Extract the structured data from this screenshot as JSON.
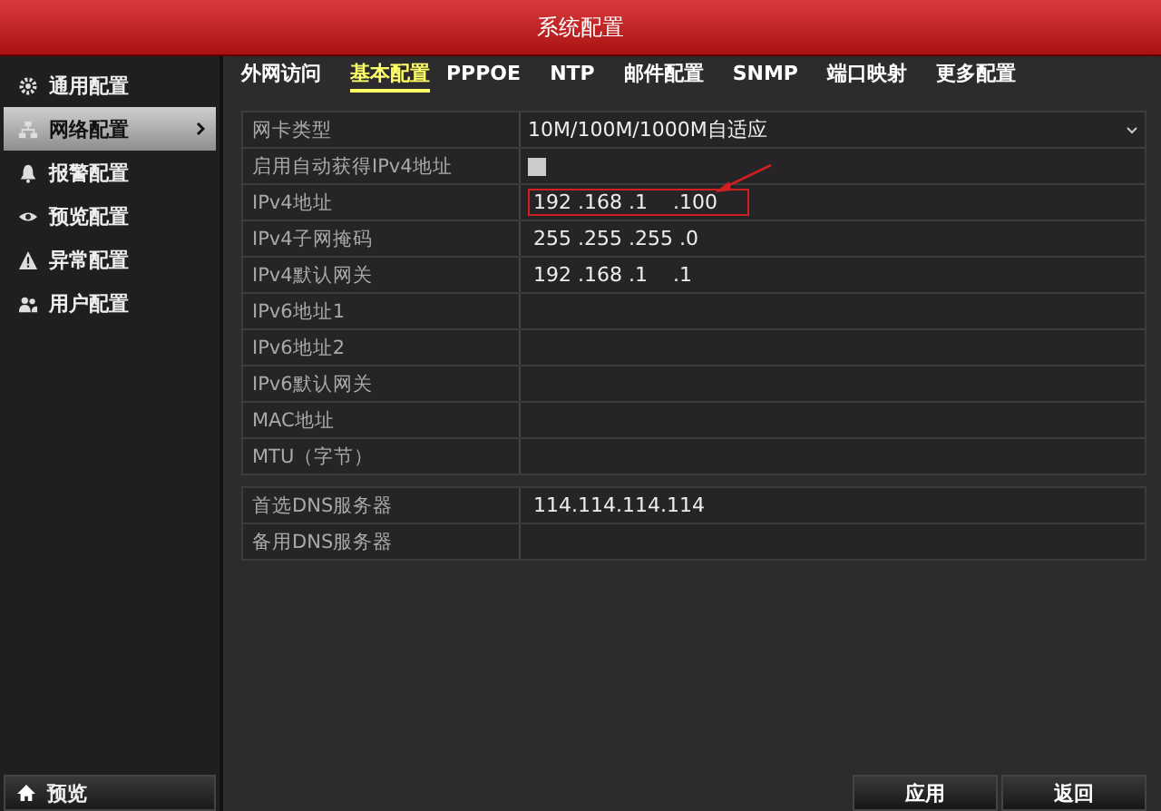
{
  "window": {
    "title": "系统配置"
  },
  "sidebar": {
    "items": [
      {
        "label": "通用配置",
        "selected": false
      },
      {
        "label": "网络配置",
        "selected": true
      },
      {
        "label": "报警配置",
        "selected": false
      },
      {
        "label": "预览配置",
        "selected": false
      },
      {
        "label": "异常配置",
        "selected": false
      },
      {
        "label": "用户配置",
        "selected": false
      }
    ],
    "bottom_button": "预览"
  },
  "tabs": [
    {
      "label": "外网访问",
      "selected": false
    },
    {
      "label": "基本配置",
      "selected": true
    },
    {
      "label": "PPPOE",
      "selected": false
    },
    {
      "label": "NTP",
      "selected": false
    },
    {
      "label": "邮件配置",
      "selected": false
    },
    {
      "label": "SNMP",
      "selected": false
    },
    {
      "label": "端口映射",
      "selected": false
    },
    {
      "label": "更多配置",
      "selected": false
    }
  ],
  "groups": [
    {
      "rows": [
        {
          "label": "网卡类型",
          "kind": "select",
          "value": "10M/100M/1000M自适应",
          "highlighted": false
        },
        {
          "label": "启用自动获得IPv4地址",
          "kind": "checkbox",
          "checked": false,
          "highlighted": false
        },
        {
          "label": "IPv4地址",
          "kind": "text",
          "value": "192 .168 .1    .100",
          "highlighted": true
        },
        {
          "label": "IPv4子网掩码",
          "kind": "text",
          "value": "255 .255 .255 .0",
          "highlighted": false
        },
        {
          "label": "IPv4默认网关",
          "kind": "text",
          "value": "192 .168 .1    .1",
          "highlighted": false
        },
        {
          "label": "IPv6地址1",
          "kind": "text",
          "highlighted": false
        },
        {
          "label": "IPv6地址2",
          "kind": "text",
          "highlighted": false
        },
        {
          "label": "IPv6默认网关",
          "kind": "text",
          "highlighted": false
        },
        {
          "label": "MAC地址",
          "kind": "text",
          "highlighted": false
        },
        {
          "label": "MTU（字节）",
          "kind": "text",
          "highlighted": false
        }
      ]
    },
    {
      "rows": [
        {
          "label": "首选DNS服务器",
          "kind": "text",
          "value": "114.114.114.114",
          "highlighted": false
        },
        {
          "label": "备用DNS服务器",
          "kind": "text",
          "highlighted": false
        }
      ]
    }
  ],
  "buttons": [
    "应用",
    "返回"
  ]
}
